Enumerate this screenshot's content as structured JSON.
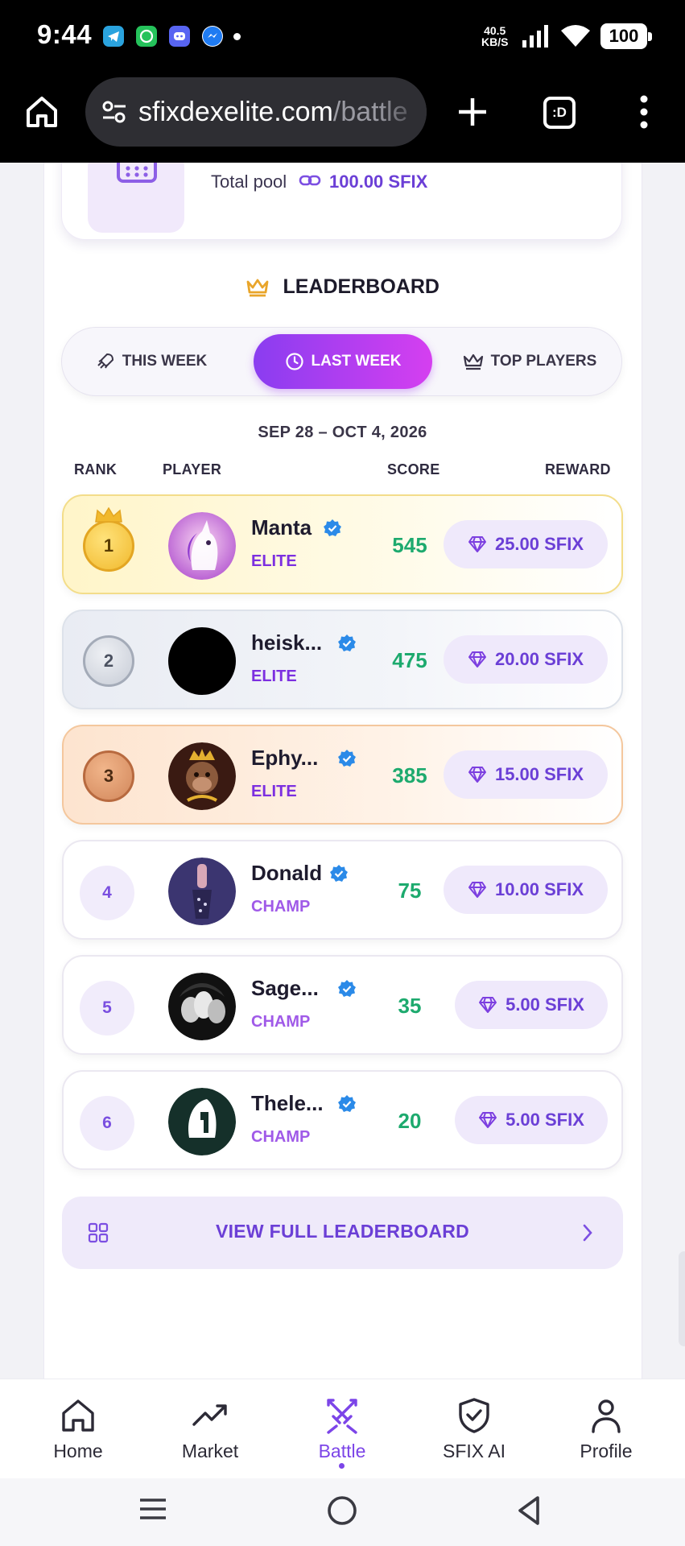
{
  "status_bar": {
    "time": "9:44",
    "speed_top": "40.5",
    "speed_bottom": "KB/S",
    "battery": "100"
  },
  "browser": {
    "url_main": "sfixdexelite.com",
    "url_rest": "/battle",
    "tab_icon": ":D"
  },
  "pool": {
    "label": "Total pool",
    "value": "100.00 SFIX"
  },
  "leaderboard": {
    "title": "LEADERBOARD",
    "tabs": [
      {
        "label": "THIS WEEK",
        "icon": "rocket-icon",
        "active": false
      },
      {
        "label": "LAST WEEK",
        "icon": "clock-icon",
        "active": true
      },
      {
        "label": "TOP PLAYERS",
        "icon": "crown-icon",
        "active": false
      }
    ],
    "date_range": "SEP 28 – OCT 4, 2026",
    "columns": {
      "rank": "RANK",
      "player": "PLAYER",
      "score": "SCORE",
      "reward": "REWARD"
    },
    "rows": [
      {
        "rank": "1",
        "name": "Manta",
        "tier": "ELITE",
        "score": "545",
        "reward": "25.00 SFIX"
      },
      {
        "rank": "2",
        "name": "heisk...",
        "tier": "ELITE",
        "score": "475",
        "reward": "20.00 SFIX"
      },
      {
        "rank": "3",
        "name": "Ephy...",
        "tier": "ELITE",
        "score": "385",
        "reward": "15.00 SFIX"
      },
      {
        "rank": "4",
        "name": "Donald",
        "tier": "CHAMP",
        "score": "75",
        "reward": "10.00 SFIX"
      },
      {
        "rank": "5",
        "name": "Sage...",
        "tier": "CHAMP",
        "score": "35",
        "reward": "5.00 SFIX"
      },
      {
        "rank": "6",
        "name": "Thele...",
        "tier": "CHAMP",
        "score": "20",
        "reward": "5.00 SFIX"
      }
    ],
    "view_full": "VIEW FULL LEADERBOARD"
  },
  "bottom_nav": [
    {
      "label": "Home",
      "icon": "home-icon",
      "active": false
    },
    {
      "label": "Market",
      "icon": "trending-icon",
      "active": false
    },
    {
      "label": "Battle",
      "icon": "swords-icon",
      "active": true
    },
    {
      "label": "SFIX AI",
      "icon": "shield-check-icon",
      "active": false
    },
    {
      "label": "Profile",
      "icon": "person-icon",
      "active": false
    }
  ],
  "colors": {
    "accent": "#7c45e8",
    "score_green": "#1daa6e",
    "tab_gradient_start": "#8a3df0",
    "tab_gradient_end": "#d53ff0"
  }
}
